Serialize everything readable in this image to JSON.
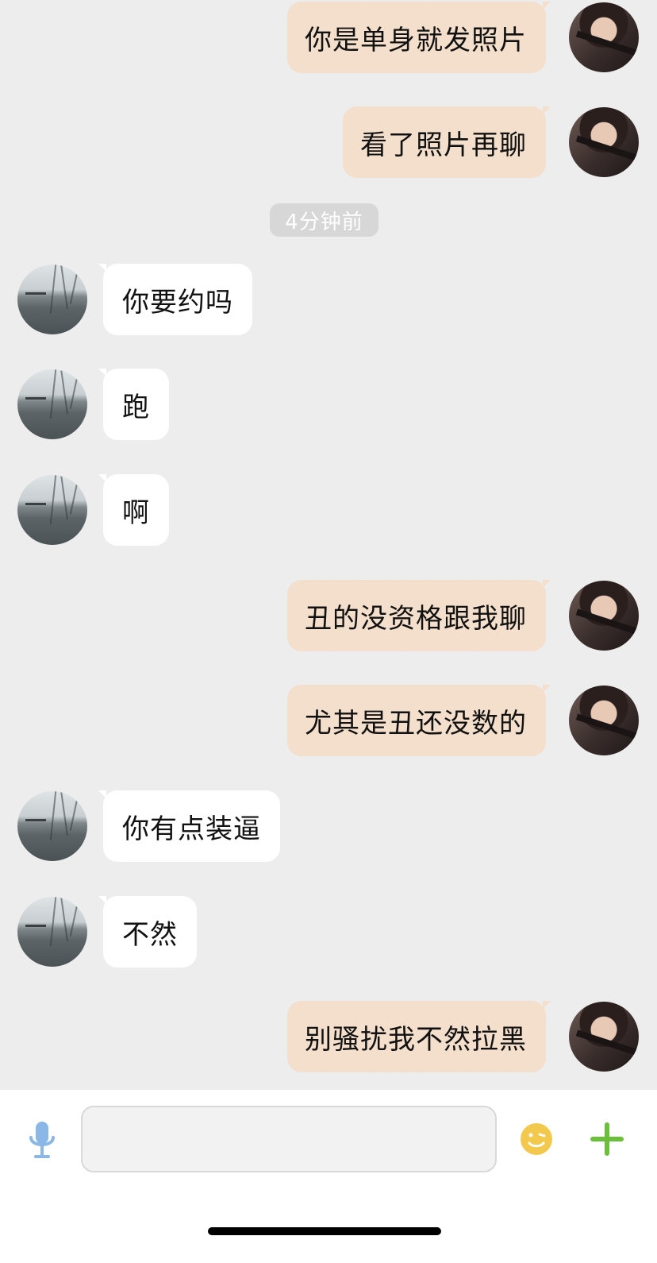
{
  "timestamp": "4分钟前",
  "messages": [
    {
      "side": "out",
      "text": "你是单身就发照片"
    },
    {
      "side": "out",
      "text": "看了照片再聊"
    },
    {
      "side": "in",
      "text": "你要约吗"
    },
    {
      "side": "in",
      "text": "跑"
    },
    {
      "side": "in",
      "text": "啊"
    },
    {
      "side": "out",
      "text": "丑的没资格跟我聊"
    },
    {
      "side": "out",
      "text": "尤其是丑还没数的"
    },
    {
      "side": "in",
      "text": "你有点装逼"
    },
    {
      "side": "in",
      "text": "不然"
    },
    {
      "side": "out",
      "text": "别骚扰我不然拉黑"
    }
  ],
  "composer": {
    "input_value": "",
    "mic_icon": "microphone-icon",
    "emoji_icon": "emoji-icon",
    "plus_icon": "plus-icon"
  },
  "colors": {
    "background": "#ededed",
    "outgoing_bubble": "#f3dfcb",
    "incoming_bubble": "#ffffff",
    "mic": "#8ab7e6",
    "emoji": "#f2c94c",
    "plus": "#6bbf3b"
  }
}
